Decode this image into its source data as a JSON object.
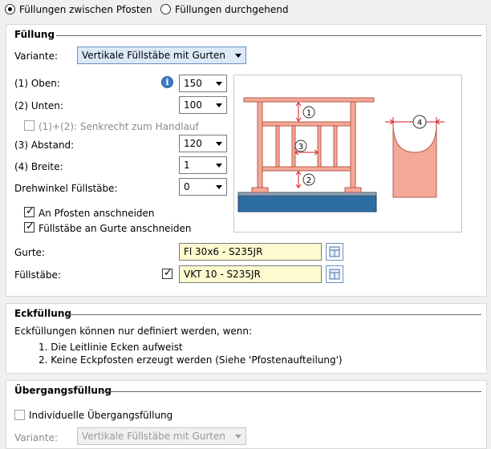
{
  "top_options": {
    "option1_label": "Füllungen zwischen Pfosten",
    "option2_label": "Füllungen durchgehend",
    "selected": 1
  },
  "fuellung": {
    "title": "Füllung",
    "variante_label": "Variante:",
    "variante_value": "Vertikale Füllstäbe mit Gurten",
    "oben_label": "(1) Oben:",
    "oben_value": "150",
    "unten_label": "(2) Unten:",
    "unten_value": "100",
    "senkrecht_label": "(1)+(2): Senkrecht zum Handlauf",
    "senkrecht_checked": false,
    "abstand_label": "(3) Abstand:",
    "abstand_value": "120",
    "breite_label": "(4) Breite:",
    "breite_value": "1",
    "drehwinkel_label": "Drehwinkel Füllstäbe:",
    "drehwinkel_value": "0",
    "pfosten_label": "An Pfosten anschneiden",
    "pfosten_checked": true,
    "gurte_anschneiden_label": "Füllstäbe an Gurte anschneiden",
    "gurte_anschneiden_checked": true,
    "gurte_label": "Gurte:",
    "gurte_value": "Fl 30x6 - S235JR",
    "fuellstaebe_label": "Füllstäbe:",
    "fuellstaebe_checked": true,
    "fuellstaebe_value": "VKT 10 - S235JR",
    "diagram_labels": [
      "1",
      "2",
      "3",
      "4"
    ],
    "info_icon": "info-icon",
    "colors": {
      "profile": "#f4a898",
      "base": "#2e6da4",
      "combo_highlight": "#dbe9f9",
      "field": "#fefad0"
    }
  },
  "eckfuellung": {
    "title": "Eckfüllung",
    "intro": "Eckfüllungen können nur definiert werden, wenn:",
    "items": [
      "1. Die Leitlinie Ecken aufweist",
      "2. Keine Eckpfosten erzeugt werden (Siehe 'Pfostenaufteilung')"
    ]
  },
  "uebergang": {
    "title": "Übergangsfüllung",
    "individuell_label": "Individuelle Übergangsfüllung",
    "individuell_checked": false,
    "variante_label": "Variante:",
    "variante_value": "Vertikale Füllstäbe mit Gurten"
  }
}
